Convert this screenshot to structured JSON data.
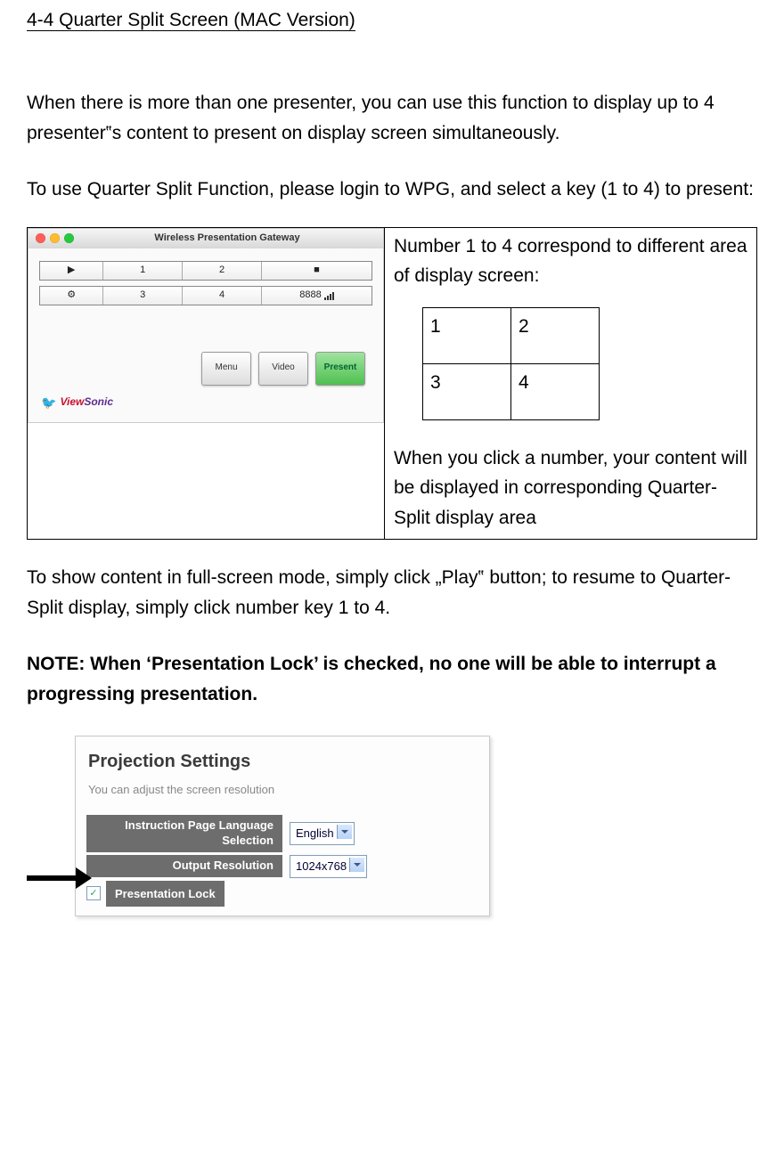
{
  "heading": "4-4 Quarter Split Screen (MAC Version)",
  "para1": "When there is more than one presenter, you can use this function to display up to 4 presenter‟s content to present on display screen simultaneously.",
  "para2": "To use Quarter Split Function, please login to WPG, and select a key (1 to 4) to present:",
  "right_top": "Number 1 to 4 correspond to different area of display screen:",
  "quad": {
    "c1": "1",
    "c2": "2",
    "c3": "3",
    "c4": "4"
  },
  "right_bottom": "When you click a number, your content will be displayed in corresponding Quarter-Split display area",
  "para3": "To show content in full-screen mode, simply click „Play‟ button; to resume to Quarter-Split display, simply click number key 1 to 4.",
  "note": "NOTE: When ‘Presentation Lock’ is checked, no one will be able to interrupt a progressing presentation.",
  "mac": {
    "title": "Wireless Presentation Gateway",
    "play": "▶",
    "n1": "1",
    "n2": "2",
    "stop": "■",
    "config": "⚙",
    "n3": "3",
    "n4": "4",
    "code": "8888",
    "menu": "Menu",
    "video": "Video",
    "present": "Present",
    "brand": "ViewSonic"
  },
  "proj": {
    "title": "Projection Settings",
    "sub": "You can adjust the screen resolution",
    "lbl_lang": "Instruction Page Language Selection",
    "val_lang": "English",
    "lbl_res": "Output Resolution",
    "val_res": "1024x768",
    "cb_checked": "✓",
    "lbl_lock": "Presentation Lock"
  }
}
